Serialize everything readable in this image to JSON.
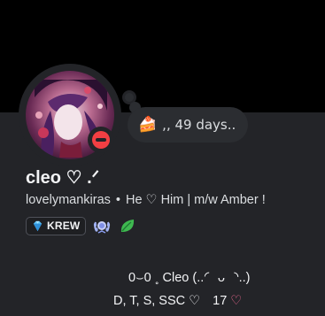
{
  "custom_status": {
    "emoji": "🍰",
    "text": ",, 49 days.."
  },
  "profile": {
    "display_name": "cleo ♡ .ᐟ",
    "username": "lovelymankiras",
    "separator": "•",
    "pronouns": "He ♡ Him | m/w Amber !",
    "status": "dnd",
    "status_color": "#f23f43"
  },
  "clan_tag": {
    "label": "KREW",
    "icon": "diamond-icon"
  },
  "badges": [
    {
      "icon": "laurel-badge-icon"
    },
    {
      "icon": "leaf-badge-icon"
    }
  ],
  "bio": {
    "line1": "0⌣0  ˳    Cleo (..◜ ᴗ ◝..)",
    "line2_text": "D, T, S, SSC ♡",
    "line2_count": "17",
    "line2_heart": "♡"
  },
  "colors": {
    "background": "#232428",
    "banner": "#000000",
    "accent_pink": "#f26b93"
  }
}
